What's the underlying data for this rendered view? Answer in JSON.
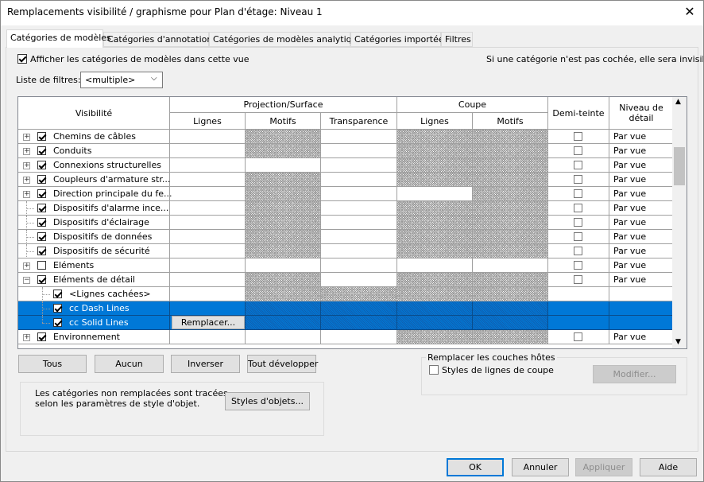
{
  "window": {
    "title": "Remplacements visibilité / graphisme pour Plan d'étage: Niveau 1",
    "close": "✕"
  },
  "tabs": [
    "Catégories de modèles",
    "Catégories d'annotations",
    "Catégories de modèles analytiques",
    "Catégories importées",
    "Filtres"
  ],
  "options": {
    "show_categories": "Afficher les catégories de modèles dans cette vue",
    "info": "Si une catégorie n'est pas cochée, elle sera invisible.",
    "filter_label": "Liste de filtres:",
    "filter_value": "<multiple>"
  },
  "headers": {
    "visibility": "Visibilité",
    "projection": "Projection/Surface",
    "cut": "Coupe",
    "halftone": "Demi-teinte",
    "detail": "Niveau de détail",
    "lines": "Lignes",
    "patterns": "Motifs",
    "transparency": "Transparence",
    "cut_lines": "Lignes",
    "cut_patterns": "Motifs"
  },
  "rows": [
    {
      "name": "Chemins de câbles",
      "detail": "Par vue"
    },
    {
      "name": "Conduits",
      "detail": "Par vue"
    },
    {
      "name": "Connexions structurelles",
      "detail": "Par vue"
    },
    {
      "name": "Coupleurs d'armature str...",
      "detail": "Par vue"
    },
    {
      "name": "Direction principale du fe...",
      "detail": "Par vue"
    },
    {
      "name": "Dispositifs d'alarme ince...",
      "detail": "Par vue"
    },
    {
      "name": "Dispositifs d'éclairage",
      "detail": "Par vue"
    },
    {
      "name": "Dispositifs de données",
      "detail": "Par vue"
    },
    {
      "name": "Dispositifs de sécurité",
      "detail": "Par vue"
    },
    {
      "name": "Eléments",
      "detail": "Par vue"
    },
    {
      "name": "Eléments de détail",
      "detail": "Par vue"
    },
    {
      "name": "<Lignes cachées>",
      "detail": ""
    },
    {
      "name": "cc Dash Lines",
      "detail": ""
    },
    {
      "name": "cc Solid Lines",
      "detail": "",
      "override": "Remplacer..."
    },
    {
      "name": "Environnement",
      "detail": "Par vue"
    }
  ],
  "buttons": {
    "all": "Tous",
    "none": "Aucun",
    "invert": "Inverser",
    "expand": "Tout développer",
    "object_styles": "Styles d'objets...",
    "modify": "Modifier...",
    "ok": "OK",
    "cancel": "Annuler",
    "apply": "Appliquer",
    "help": "Aide"
  },
  "host": {
    "title": "Remplacer les couches hôtes",
    "cut_styles": "Styles de lignes de coupe"
  },
  "note": {
    "line1": "Les catégories non remplacées sont tracées",
    "line2": "selon les paramètres de style d'objet."
  }
}
